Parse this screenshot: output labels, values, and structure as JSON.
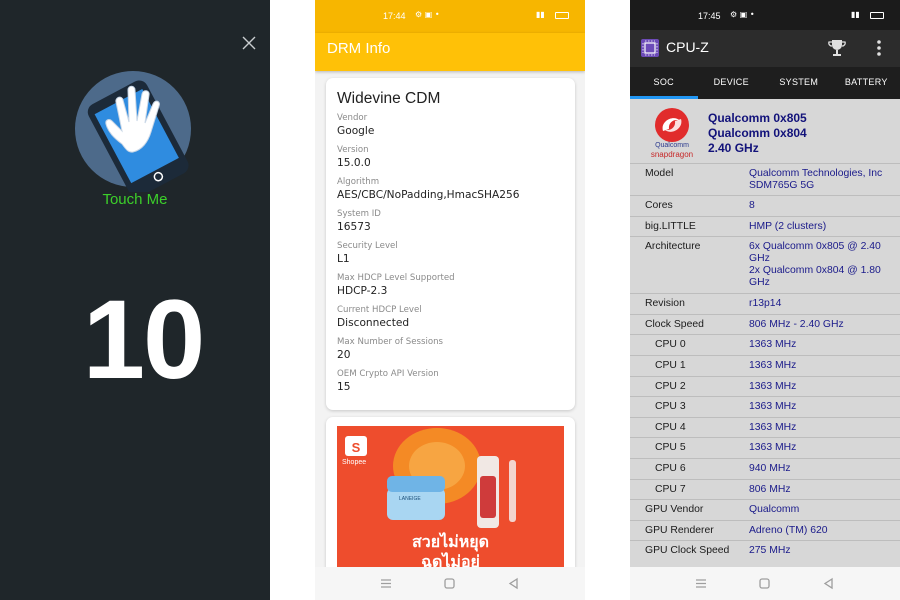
{
  "panel_touch": {
    "touch_label": "Touch Me",
    "count": "10"
  },
  "panel_drm": {
    "status": {
      "time": "17:44"
    },
    "appbar_title": "DRM Info",
    "card_title": "Widevine CDM",
    "fields": [
      {
        "label": "Vendor",
        "value": "Google"
      },
      {
        "label": "Version",
        "value": "15.0.0"
      },
      {
        "label": "Algorithm",
        "value": "AES/CBC/NoPadding,HmacSHA256"
      },
      {
        "label": "System ID",
        "value": "16573"
      },
      {
        "label": "Security Level",
        "value": "L1"
      },
      {
        "label": "Max HDCP Level Supported",
        "value": "HDCP-2.3"
      },
      {
        "label": "Current HDCP Level",
        "value": "Disconnected"
      },
      {
        "label": "Max Number of Sessions",
        "value": "20"
      },
      {
        "label": "OEM Crypto API Version",
        "value": "15"
      }
    ],
    "ad": {
      "brand": "Shopee",
      "product_brand": "LANEIGE",
      "headline_line1": "สวยไม่หยุด",
      "headline_line2": "ฉดไม่อย่"
    }
  },
  "panel_cpuz": {
    "status": {
      "time": "17:45"
    },
    "appbar_title": "CPU-Z",
    "tabs": [
      "SOC",
      "DEVICE",
      "SYSTEM",
      "BATTERY"
    ],
    "logo_text_1": "Qualcomm",
    "logo_text_2": "snapdragon",
    "soc_lines": [
      "Qualcomm 0x805",
      "Qualcomm 0x804",
      "2.40 GHz"
    ],
    "rows": [
      {
        "label": "Model",
        "value": "Qualcomm Technologies, Inc SDM765G 5G"
      },
      {
        "label": "Cores",
        "value": "8"
      },
      {
        "label": "big.LITTLE",
        "value": "HMP (2 clusters)"
      },
      {
        "label": "Architecture",
        "value": "6x Qualcomm 0x805 @ 2.40 GHz\n2x Qualcomm 0x804 @ 1.80 GHz"
      },
      {
        "label": "Revision",
        "value": "r13p14"
      },
      {
        "label": "Clock Speed",
        "value": "806 MHz - 2.40 GHz"
      },
      {
        "label": "CPU 0",
        "value": "1363 MHz"
      },
      {
        "label": "CPU 1",
        "value": "1363 MHz"
      },
      {
        "label": "CPU 2",
        "value": "1363 MHz"
      },
      {
        "label": "CPU 3",
        "value": "1363 MHz"
      },
      {
        "label": "CPU 4",
        "value": "1363 MHz"
      },
      {
        "label": "CPU 5",
        "value": "1363 MHz"
      },
      {
        "label": "CPU 6",
        "value": "940 MHz"
      },
      {
        "label": "CPU 7",
        "value": "806 MHz"
      },
      {
        "label": "GPU Vendor",
        "value": "Qualcomm"
      },
      {
        "label": "GPU Renderer",
        "value": "Adreno (TM) 620"
      },
      {
        "label": "GPU Clock Speed",
        "value": "275 MHz"
      }
    ]
  },
  "colors": {
    "drm_accent": "#ffc107",
    "touch_label": "#3ccf2a",
    "cpuz_value": "#1a1a8a",
    "cpuz_tab_indicator": "#2196f3",
    "shopee": "#ee4d2d"
  }
}
